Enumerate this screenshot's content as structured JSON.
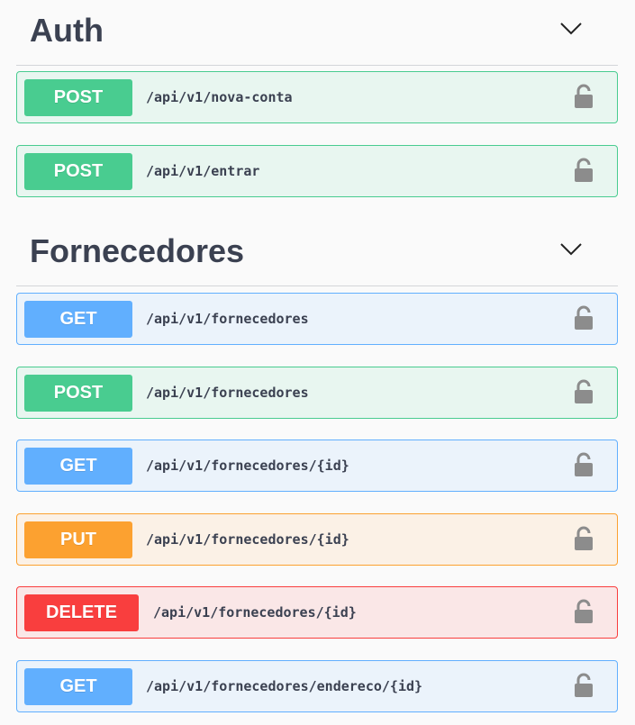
{
  "sections": [
    {
      "title": "Auth",
      "operations": [
        {
          "method": "POST",
          "path": "/api/v1/nova-conta"
        },
        {
          "method": "POST",
          "path": "/api/v1/entrar"
        }
      ]
    },
    {
      "title": "Fornecedores",
      "operations": [
        {
          "method": "GET",
          "path": "/api/v1/fornecedores"
        },
        {
          "method": "POST",
          "path": "/api/v1/fornecedores"
        },
        {
          "method": "GET",
          "path": "/api/v1/fornecedores/{id}"
        },
        {
          "method": "PUT",
          "path": "/api/v1/fornecedores/{id}"
        },
        {
          "method": "DELETE",
          "path": "/api/v1/fornecedores/{id}"
        },
        {
          "method": "GET",
          "path": "/api/v1/fornecedores/endereco/{id}"
        }
      ]
    }
  ],
  "icons": {
    "expand": "chevron-down-icon",
    "auth": "lock-icon"
  },
  "colors": {
    "post": "#49cc90",
    "get": "#61affe",
    "put": "#fca130",
    "delete": "#f93e3e",
    "text": "#3b4151",
    "lock": "#8c8c8c"
  }
}
